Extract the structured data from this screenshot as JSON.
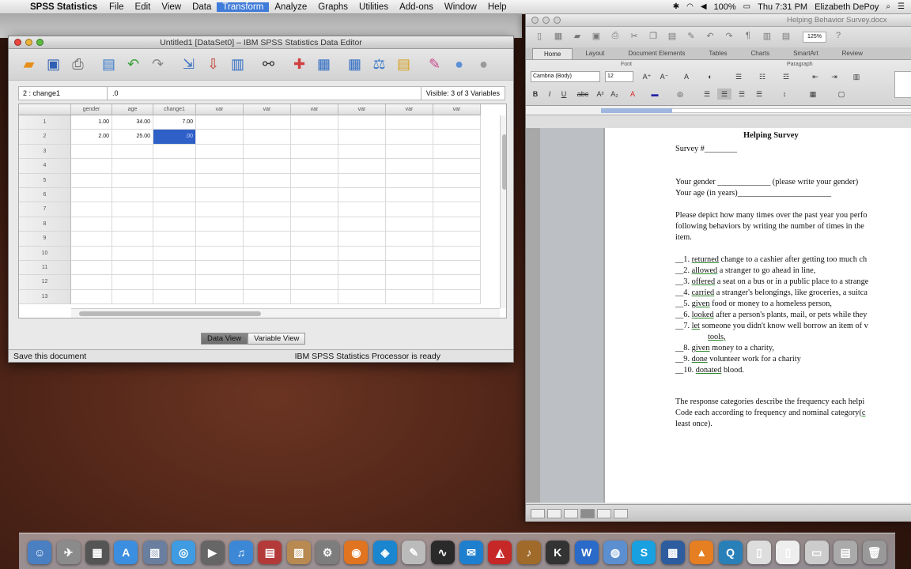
{
  "menubar": {
    "app": "SPSS Statistics",
    "items": [
      "File",
      "Edit",
      "View",
      "Data",
      "Transform",
      "Analyze",
      "Graphs",
      "Utilities",
      "Add-ons",
      "Window",
      "Help"
    ],
    "battery": "100%",
    "clock": "Thu 7:31 PM",
    "user": "Elizabeth DePoy"
  },
  "spss": {
    "title": "Untitled1 [DataSet0] – IBM SPSS Statistics Data Editor",
    "cell_ref": "2 : change1",
    "cell_value": ".0",
    "visible": "Visible: 3 of 3 Variables",
    "columns": [
      "gender",
      "age",
      "change1",
      "var",
      "var",
      "var",
      "var",
      "var",
      "var"
    ],
    "rows": [
      "1",
      "2",
      "3",
      "4",
      "5",
      "6",
      "7",
      "8",
      "9",
      "10",
      "11",
      "12",
      "13"
    ],
    "data": [
      [
        "1.00",
        "34.00",
        "7.00"
      ],
      [
        "2.00",
        "25.00",
        ".00"
      ]
    ],
    "tab_data_view": "Data View",
    "tab_variable_view": "Variable View",
    "status_left": "Save this document",
    "status_right": "IBM SPSS Statistics Processor is ready"
  },
  "word": {
    "title": "Helping Behavior Survey.docx",
    "zoom": "125%",
    "tabs": [
      "Home",
      "Layout",
      "Document Elements",
      "Tables",
      "Charts",
      "SmartArt",
      "Review"
    ],
    "group_font": "Font",
    "group_paragraph": "Paragraph",
    "font_name": "Cambria (Body)",
    "font_size": "12",
    "doc": {
      "title": "Helping Survey",
      "survey_num": "Survey #________",
      "gender_line": "Your gender _____________ (please write your gender)",
      "age_line": "Your age (in years)_______________________",
      "intro1": "Please depict how many times over the past year you perfo",
      "intro2": "following behaviors by writing the number of times in the",
      "intro3": "item.",
      "items": [
        {
          "num": "__1.",
          "verb": "returned",
          "rest": "change to a cashier after getting too much ch"
        },
        {
          "num": "__2.",
          "verb": "allowed",
          "rest": "a stranger to go ahead in line,"
        },
        {
          "num": "__3.",
          "verb": "offered",
          "rest": "a seat on a bus or in a public place to a strange"
        },
        {
          "num": "__4.",
          "verb": "carried",
          "rest": "a stranger's belongings, like groceries, a suitca"
        },
        {
          "num": "__5.",
          "verb": "given",
          "rest": "food or money to a homeless person,"
        },
        {
          "num": "__6.",
          "verb": "looked",
          "rest": "after a person's plants, mail, or pets while they"
        },
        {
          "num": "__7.",
          "verb": "let",
          "rest": "someone you didn't know well borrow an item of v"
        },
        {
          "num": "",
          "verb": "tools,",
          "rest": ""
        },
        {
          "num": "__8.",
          "verb": "given",
          "rest": "money to a charity,"
        },
        {
          "num": "__9.",
          "verb": "done",
          "rest": "volunteer work for a charity"
        },
        {
          "num": "__10.",
          "verb": "donated",
          "rest": "blood."
        }
      ],
      "outro1": "The response categories describe the frequency each helpi",
      "outro2": "Code each according to frequency and nominal category(",
      "outro2_link": "c",
      "outro3": "least once)."
    }
  },
  "colors": {
    "selection": "#2f60c8",
    "menu_active": "#3f7bd8"
  }
}
